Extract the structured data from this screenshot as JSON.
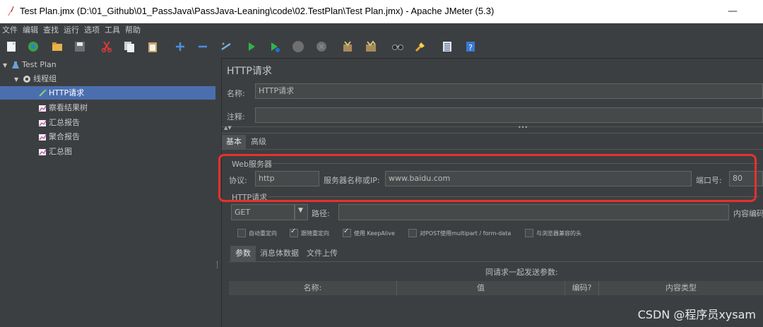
{
  "window": {
    "title": "Test Plan.jmx (D:\\01_Github\\01_PassJava\\PassJava-Leaning\\code\\02.TestPlan\\Test Plan.jmx) - Apache JMeter (5.3)",
    "minimize": "—"
  },
  "menu": [
    "文件",
    "编辑",
    "查找",
    "运行",
    "选项",
    "工具",
    "帮助"
  ],
  "toolbar": {
    "icons": [
      "new-icon",
      "templates-icon",
      "open-icon",
      "save-icon",
      "cut-icon",
      "copy-icon",
      "paste-icon",
      "expand-icon",
      "collapse-icon",
      "toggle-icon",
      "start-icon",
      "start-no-timers-icon",
      "stop-icon",
      "shutdown-icon",
      "clear-icon",
      "clear-all-icon",
      "search-icon",
      "reset-search-icon",
      "function-helper-icon",
      "help-icon"
    ]
  },
  "tree": {
    "root": "Test Plan",
    "thread_group": "线程组",
    "items": [
      "HTTP请求",
      "察看结果树",
      "汇总报告",
      "聚合报告",
      "汇总图"
    ],
    "selected": "HTTP请求"
  },
  "panel": {
    "title": "HTTP请求",
    "name_label": "名称:",
    "name_value": "HTTP请求",
    "comment_label": "注释:",
    "comment_value": "",
    "tabs": [
      "基本",
      "高级"
    ],
    "active_tab": "基本",
    "web_server": {
      "section_label": "Web服务器",
      "protocol_label": "协议:",
      "protocol_value": "http",
      "server_label": "服务器名称或IP:",
      "server_value": "www.baidu.com",
      "port_label": "端口号:",
      "port_value": "80"
    },
    "http_request": {
      "section_label": "HTTP请求",
      "method": "GET",
      "path_label": "路径:",
      "path_value": "",
      "encoding_label": "内容编码"
    },
    "checkboxes": [
      {
        "label": "自动重定向",
        "checked": false
      },
      {
        "label": "跟随重定向",
        "checked": true
      },
      {
        "label": "使用 KeepAlive",
        "checked": true
      },
      {
        "label": "对POST使用multipart / form-data",
        "checked": false
      },
      {
        "label": "与浏览器兼容的头",
        "checked": false
      }
    ],
    "sub_tabs": [
      "参数",
      "消息体数据",
      "文件上传"
    ],
    "active_sub_tab": "参数",
    "params_caption": "同请求一起发送参数:",
    "columns": [
      "名称:",
      "值",
      "编码?",
      "内容类型"
    ]
  },
  "watermark": "CSDN @程序员xysam",
  "colors": {
    "selection": "#4b6eaf",
    "highlight_box": "#e5322d",
    "background": "#3c3f41"
  }
}
